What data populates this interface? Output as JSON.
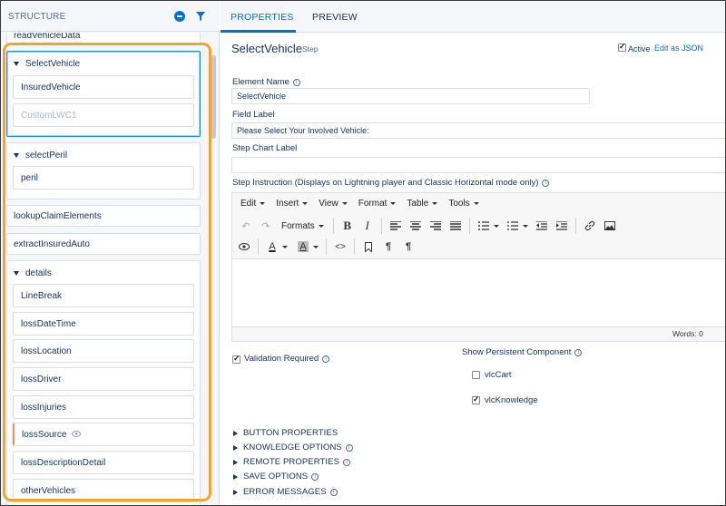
{
  "structure": {
    "title": "STRUCTURE",
    "items": {
      "read_vehicle_data": "readVehicleData",
      "select_vehicle": {
        "label": "SelectVehicle",
        "children": [
          "InsuredVehicle",
          "CustomLWC1"
        ]
      },
      "select_peril": {
        "label": "selectPeril",
        "children": [
          "peril"
        ]
      },
      "lookup_claim_elements": "lookupClaimElements",
      "extract_insured_auto": "extractInsuredAuto",
      "details": {
        "label": "details",
        "children": [
          "LineBreak",
          "lossDateTime",
          "lossLocation",
          "lossDriver",
          "lossInjuries",
          "lossSource",
          "lossDescriptionDetail",
          "otherVehicles"
        ]
      }
    }
  },
  "tabs": {
    "properties": "PROPERTIES",
    "preview": "PREVIEW"
  },
  "step": {
    "name": "SelectVehicle",
    "type": "Step",
    "active_label": "Active",
    "edit_json": "Edit as JSON"
  },
  "fields": {
    "element_name_label": "Element Name",
    "element_name_value": "SelectVehicle",
    "field_label_label": "Field Label",
    "field_label_value": "Please Select Your Involved Vehicle:",
    "step_chart_label": "Step Chart Label",
    "step_chart_value": "",
    "step_instruction_label": "Step Instruction (Displays on Lightning player and Classic Horizontal mode only)"
  },
  "editor": {
    "menus": [
      "Edit",
      "Insert",
      "View",
      "Format",
      "Table",
      "Tools"
    ],
    "formats": "Formats",
    "words": "Words: 0"
  },
  "options": {
    "validation_required": "Validation Required",
    "show_persistent": "Show Persistent Component",
    "vlc_cart": "vlcCart",
    "vlc_knowledge": "vlcKnowledge"
  },
  "sections": [
    "BUTTON PROPERTIES",
    "KNOWLEDGE OPTIONS",
    "REMOTE PROPERTIES",
    "SAVE OPTIONS",
    "ERROR MESSAGES"
  ],
  "colors": {
    "accent": "#0070d2",
    "highlight": "#f0a531",
    "selected_border": "#1589ee"
  }
}
